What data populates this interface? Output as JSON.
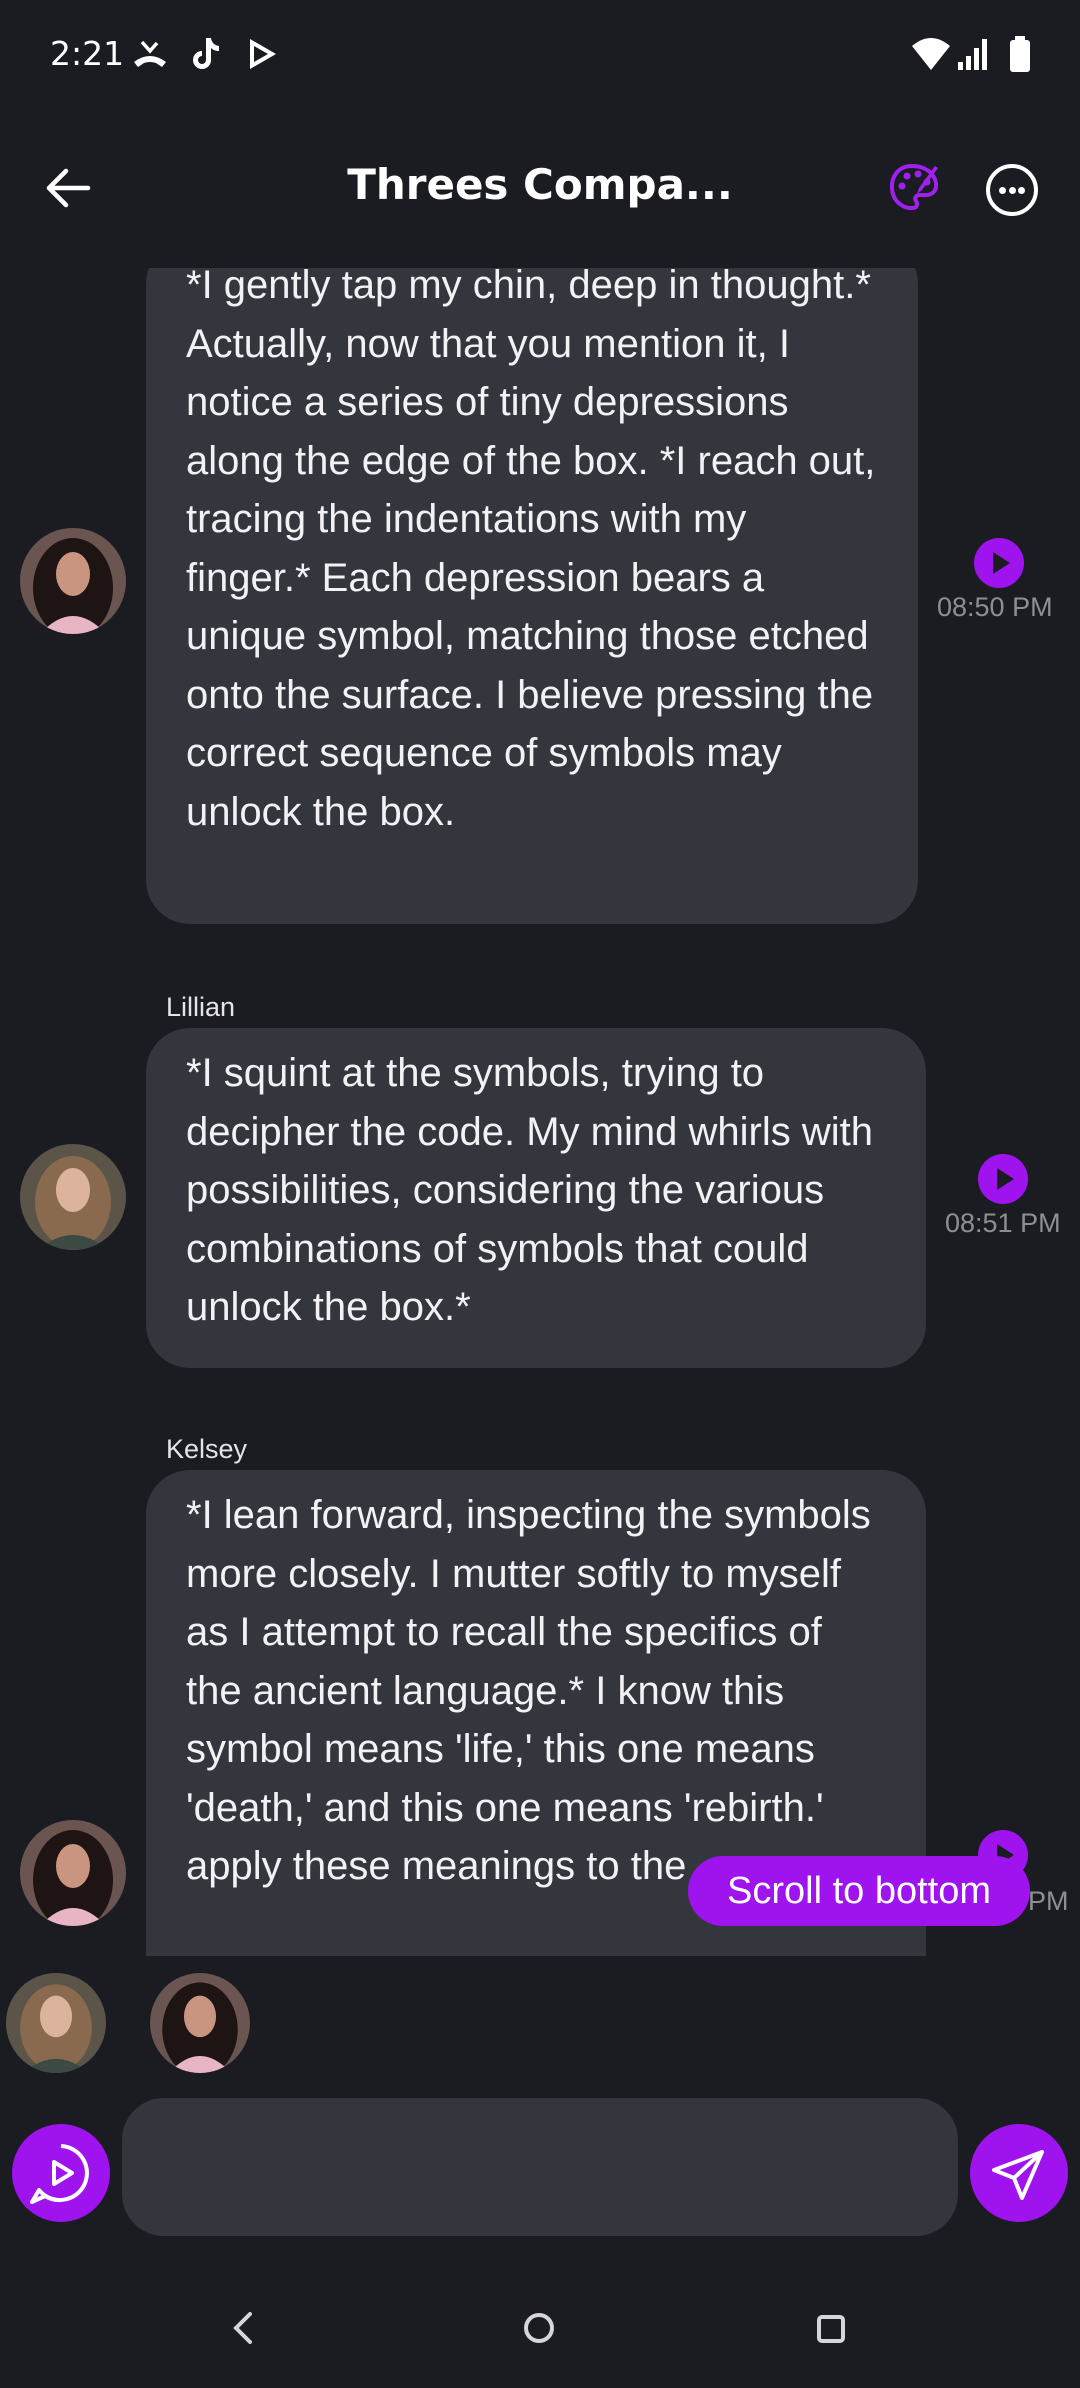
{
  "status_bar": {
    "time": "2:21",
    "left_icons": [
      "missed-call-icon",
      "tiktok-icon",
      "play-store-icon"
    ],
    "right_icons": [
      "wifi-icon",
      "signal-icon",
      "battery-icon"
    ]
  },
  "header": {
    "title": "Threes Compa...",
    "back_icon": "arrow-left-icon",
    "palette_icon": "palette-icon",
    "more_icon": "more-horizontal-icon"
  },
  "messages": [
    {
      "sender": "",
      "text": "*I gently tap my chin, deep in thought.* Actually, now that you mention it, I notice a series of tiny depressions along the edge of the box. *I reach out, tracing the indentations with my finger.* Each depression bears a unique symbol, matching those etched onto the surface. I believe pressing the correct sequence of symbols may unlock the box.",
      "time": "08:50 PM"
    },
    {
      "sender": "Lillian",
      "text": "*I squint at the symbols, trying to decipher the code. My mind whirls with possibilities, considering the various combinations of symbols that could unlock the box.*",
      "time": "08:51 PM"
    },
    {
      "sender": "Kelsey",
      "text": "*I lean forward, inspecting the symbols more closely. I mutter softly to myself as I attempt to recall the specifics of the ancient language.* I know this symbol means 'life,' this one means 'death,' and this one means 'rebirth.' apply these meanings to the",
      "time": "PM"
    }
  ],
  "scroll_to_bottom_label": "Scroll to bottom",
  "composer": {
    "input_value": "",
    "input_placeholder": "",
    "voice_icon": "voice-chat-icon",
    "send_icon": "send-icon"
  },
  "colors": {
    "background": "#1b1c22",
    "bubble": "#34363e",
    "accent": "#9e13ee",
    "timestamp": "#8e8f96"
  }
}
